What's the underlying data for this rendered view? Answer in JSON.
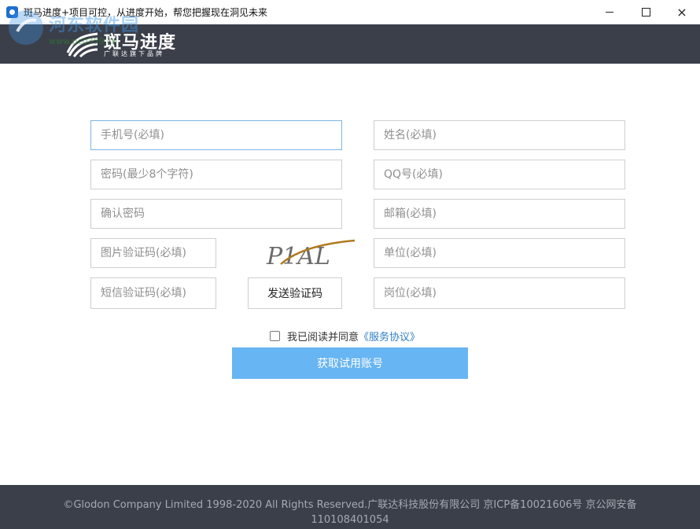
{
  "window": {
    "title": "斑马进度+项目可控，从进度开始，帮您把握现在洞见未来",
    "min_glyph": "minimize-icon",
    "max_glyph": "maximize-icon",
    "close_glyph": "×"
  },
  "watermark": {
    "text": "河东软件园",
    "url": "www.pc0359.cn"
  },
  "header": {
    "logo_name": "斑马进度",
    "logo_sub": "广联达旗下品牌"
  },
  "form": {
    "phone_placeholder": "手机号(必填)",
    "name_placeholder": "姓名(必填)",
    "password_placeholder": "密码(最少8个字符)",
    "qq_placeholder": "QQ号(必填)",
    "confirm_placeholder": "确认密码",
    "email_placeholder": "邮箱(必填)",
    "image_code_placeholder": "图片验证码(必填)",
    "company_placeholder": "单位(必填)",
    "sms_code_placeholder": "短信验证码(必填)",
    "position_placeholder": "岗位(必填)",
    "captcha_text": "P1AL",
    "send_code_label": "发送验证码",
    "agree_text": "我已阅读并同意",
    "agree_link": "《服务协议》",
    "submit_label": "获取试用账号"
  },
  "footer": {
    "copyright": "©Glodon Company Limited 1998-2020 All Rights Reserved.广联达科技股份有限公司 京ICP备10021606号 京公网安备110108401054"
  },
  "colors": {
    "header_bg": "#3b3f4a",
    "submit_bg": "#67b5f2",
    "link": "#2d7fc6"
  }
}
